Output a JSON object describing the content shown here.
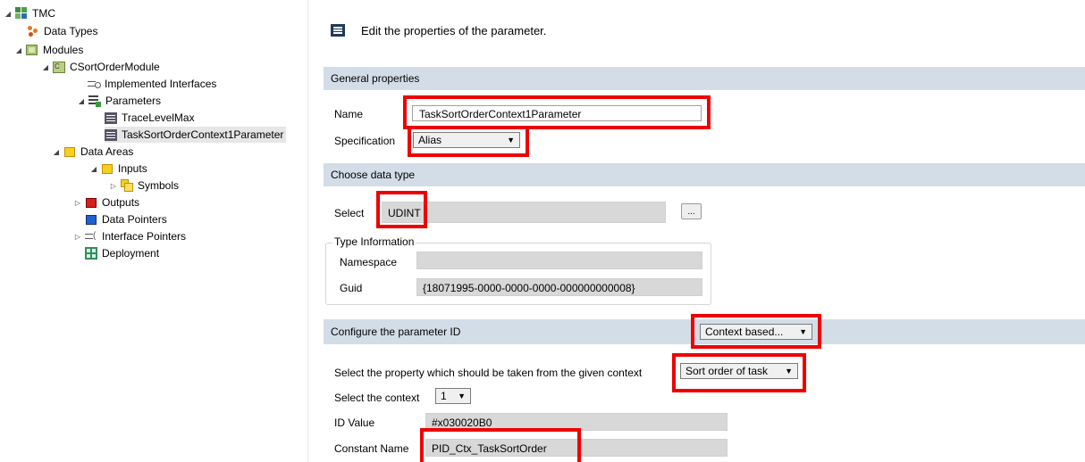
{
  "tree": {
    "items": [
      {
        "label": "TMC",
        "icon": "tmc-icon",
        "twisty": "◢"
      },
      {
        "label": "Data Types",
        "icon": "data-types-icon",
        "twisty": ""
      },
      {
        "label": "Modules",
        "icon": "modules-icon",
        "twisty": "◢"
      },
      {
        "label": "CSortOrderModule",
        "icon": "module-icon",
        "twisty": "◢"
      },
      {
        "label": "Implemented Interfaces",
        "icon": "interface-icon",
        "twisty": ""
      },
      {
        "label": "Parameters",
        "icon": "parameters-icon",
        "twisty": "◢"
      },
      {
        "label": "TraceLevelMax",
        "icon": "parameter-icon",
        "twisty": ""
      },
      {
        "label": "TaskSortOrderContext1Parameter",
        "icon": "parameter-icon",
        "twisty": ""
      },
      {
        "label": "Data Areas",
        "icon": "data-areas-icon",
        "twisty": "◢"
      },
      {
        "label": "Inputs",
        "icon": "inputs-icon",
        "twisty": "◢"
      },
      {
        "label": "Symbols",
        "icon": "symbols-icon",
        "twisty": "▷"
      },
      {
        "label": "Outputs",
        "icon": "outputs-icon",
        "twisty": "▷"
      },
      {
        "label": "Data Pointers",
        "icon": "data-pointers-icon",
        "twisty": ""
      },
      {
        "label": "Interface Pointers",
        "icon": "interface-pointers-icon",
        "twisty": "▷"
      },
      {
        "label": "Deployment",
        "icon": "deployment-icon",
        "twisty": ""
      }
    ]
  },
  "header": {
    "title": "Edit the properties of the parameter.",
    "icon": "menu-icon"
  },
  "general": {
    "section_title": "General properties",
    "name_label": "Name",
    "name_value": "TaskSortOrderContext1Parameter",
    "spec_label": "Specification",
    "spec_value": "Alias"
  },
  "datatype": {
    "section_title": "Choose data type",
    "select_label": "Select",
    "select_value": "UDINT",
    "browse_label": "...",
    "type_info_title": "Type Information",
    "namespace_label": "Namespace",
    "namespace_value": "",
    "guid_label": "Guid",
    "guid_value": "{18071995-0000-0000-0000-000000000008}"
  },
  "paramid": {
    "section_title": "Configure the parameter ID",
    "mode_value": "Context based...",
    "property_label": "Select the property which should be taken from the given context",
    "property_value": "Sort order of task",
    "context_label": "Select the context",
    "context_value": "1",
    "id_label": "ID Value",
    "id_value": "#x030020B0",
    "const_label": "Constant Name",
    "const_value": "PID_Ctx_TaskSortOrder"
  },
  "colors": {
    "section_bg": "#d3dde8",
    "highlight": "#ee0000",
    "selected_bg": "#e6e6e6"
  }
}
